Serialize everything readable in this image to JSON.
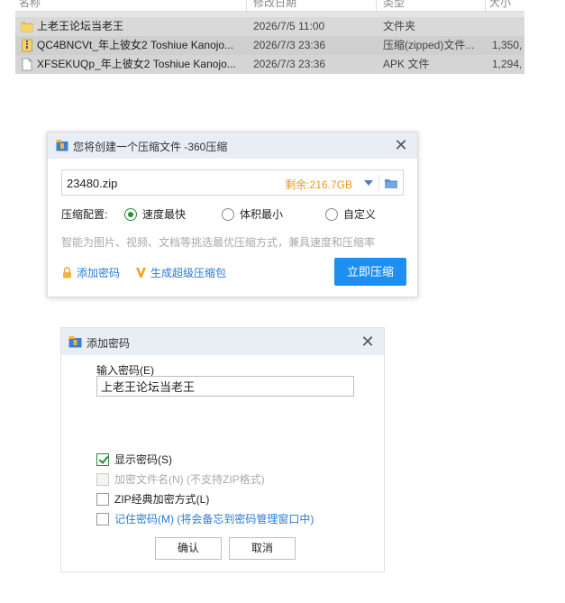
{
  "explorer": {
    "columns": [
      "名称",
      "修改日期",
      "类型",
      "大小"
    ],
    "files": [
      {
        "icon": "folder-icon",
        "name": "上老王论坛当老王",
        "date": "2026/7/5 11:00",
        "type": "文件夹",
        "size": ""
      },
      {
        "icon": "zip-file-icon",
        "name": "QC4BNCVt_年上彼女2 Toshiue Kanojo...",
        "date": "2026/7/3 23:36",
        "type": "压缩(zipped)文件...",
        "size": "1,350,"
      },
      {
        "icon": "file-icon",
        "name": "XFSEKUQp_年上彼女2 Toshiue Kanojo...",
        "date": "2026/7/3 23:36",
        "type": "APK 文件",
        "size": "1,294,"
      }
    ]
  },
  "compress_dialog": {
    "title": "您将创建一个压缩文件 -360压缩",
    "close": "✕",
    "filename": "23480.zip",
    "remaining": "剩余:216.7GB",
    "config_label": "压缩配置:",
    "options": [
      {
        "label": "速度最快",
        "selected": true
      },
      {
        "label": "体积最小",
        "selected": false
      },
      {
        "label": "自定义",
        "selected": false
      }
    ],
    "hint": "智能为图片、视频、文档等挑选最优压缩方式，兼具速度和压缩率",
    "add_password": "添加密码",
    "super_zip": "生成超级压缩包",
    "compress_button": "立即压缩"
  },
  "password_dialog": {
    "title": "添加密码",
    "close": "✕",
    "input_label": "输入密码(E)",
    "password_value": "上老王论坛当老王",
    "checkboxes": [
      {
        "label": "显示密码(S)",
        "checked": true,
        "disabled": false
      },
      {
        "label": "加密文件名(N) (不支持ZIP格式)",
        "checked": false,
        "disabled": true
      },
      {
        "label": "ZIP经典加密方式(L)",
        "checked": false,
        "disabled": false
      },
      {
        "label": "记住密码(M) (将会备忘到密码管理窗口中)",
        "checked": false,
        "disabled": false
      }
    ],
    "ok_button": "确认",
    "cancel_button": "取消"
  },
  "colors": {
    "accent_blue": "#1e8ff0",
    "link_blue": "#2a7ad6",
    "remaining_orange": "#e89a22",
    "check_green": "#2a8c3a"
  }
}
